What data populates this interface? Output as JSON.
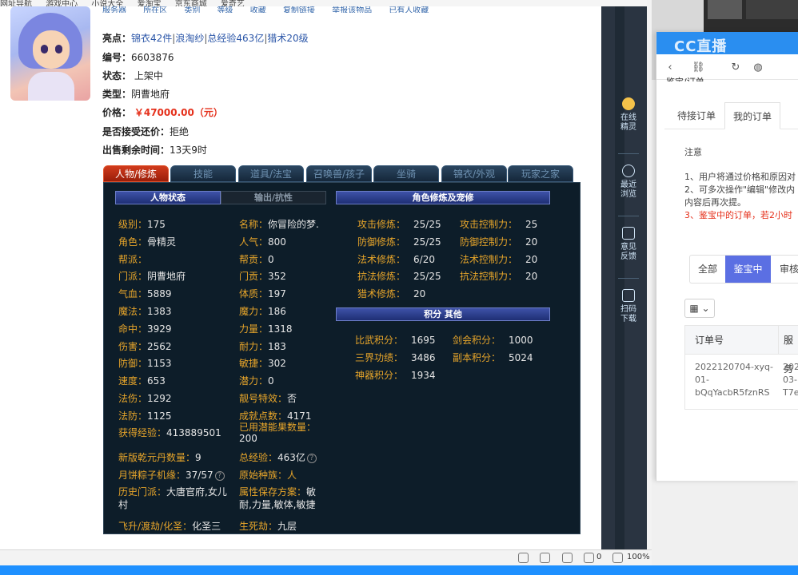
{
  "bookmarks": [
    "网址导航",
    "游戏中心",
    "小说大全",
    "爱淘宝",
    "京东商城",
    "爱奇艺"
  ],
  "meta_top": [
    "服务器",
    "所在区",
    "类别",
    "等级",
    "收藏",
    "复制链接",
    "举报该物品",
    "已有人收藏"
  ],
  "info": {
    "highlights_label": "亮点：",
    "highlights": [
      "锦衣42件",
      "浪淘纱",
      "总经验463亿",
      "猎术20级"
    ],
    "id_label": "编号：",
    "id_value": "6603876",
    "status_label": "状态：",
    "status_value": "上架中",
    "type_label": "类型：",
    "type_value": "阴曹地府",
    "price_label": "价格：",
    "price_value": "￥47000.00（元）",
    "bargain_label": "是否接受还价：",
    "bargain_value": "拒绝",
    "remaining_label": "出售剩余时间：",
    "remaining_value": "13天9时"
  },
  "tabs": [
    "人物/修炼",
    "技能",
    "道具/法宝",
    "召唤兽/孩子",
    "坐骑",
    "锦衣/外观",
    "玩家之家"
  ],
  "panel": {
    "subtab_on": "人物状态",
    "subtab_off": "输出/抗性",
    "cultivation_title": "角色修炼及宠修",
    "score_title": "积分 其他",
    "left_col": [
      {
        "k": "级别：",
        "v": "175"
      },
      {
        "k": "角色：",
        "v": "骨精灵"
      },
      {
        "k": "帮派：",
        "v": ""
      },
      {
        "k": "门派：",
        "v": "阴曹地府"
      },
      {
        "k": "气血：",
        "v": "5889"
      },
      {
        "k": "魔法：",
        "v": "1383"
      },
      {
        "k": "命中：",
        "v": "3929"
      },
      {
        "k": "伤害：",
        "v": "2562"
      },
      {
        "k": "防御：",
        "v": "1153"
      },
      {
        "k": "速度：",
        "v": "653"
      },
      {
        "k": "法伤：",
        "v": "1292"
      },
      {
        "k": "法防：",
        "v": "1125"
      }
    ],
    "mid_col": [
      {
        "k": "名称：",
        "v": "你冒险的梦."
      },
      {
        "k": "人气：",
        "v": "800"
      },
      {
        "k": "帮贡：",
        "v": "0"
      },
      {
        "k": "门贡：",
        "v": "352"
      },
      {
        "k": "体质：",
        "v": "197"
      },
      {
        "k": "魔力：",
        "v": "186"
      },
      {
        "k": "力量：",
        "v": "1318"
      },
      {
        "k": "耐力：",
        "v": "183"
      },
      {
        "k": "敏捷：",
        "v": "302"
      },
      {
        "k": "潜力：",
        "v": "0"
      },
      {
        "k": "靓号特效：",
        "v": "否"
      },
      {
        "k": "成就点数：",
        "v": "4171"
      }
    ],
    "exp_label": "获得经验：",
    "exp_value": "413889501",
    "potential_label": "已用潜能果数量：",
    "potential_value": "200",
    "qiankun_label": "新版乾元丹数量：",
    "qiankun_value": "9",
    "total_exp_label": "总经验：",
    "total_exp_value": "463亿",
    "zongzi_label": "月饼粽子机缘：",
    "zongzi_value": "37/57",
    "race_label": "原始种族：",
    "race_value": "人",
    "history_label": "历史门派：",
    "history_value_1": "大唐官府,女儿",
    "history_value_2": "村",
    "attr_label": "属性保存方案：",
    "attr_label_2": "敏",
    "attr_value": "耐,力量,敏体,敏捷",
    "fly_label": "飞升/渡劫/化圣：",
    "fly_value": "化圣三",
    "life_label": "生死劫：",
    "life_value": "九层",
    "cultivation": [
      {
        "k": "攻击修炼：",
        "v": "25/25",
        "k2": "攻击控制力：",
        "v2": "25"
      },
      {
        "k": "防御修炼：",
        "v": "25/25",
        "k2": "防御控制力：",
        "v2": "20"
      },
      {
        "k": "法术修炼：",
        "v": "6/20",
        "k2": "法术控制力：",
        "v2": "20"
      },
      {
        "k": "抗法修炼：",
        "v": "25/25",
        "k2": "抗法控制力：",
        "v2": "20"
      },
      {
        "k": "猎术修炼：",
        "v": "20",
        "k2": "",
        "v2": ""
      }
    ],
    "scores": [
      {
        "k": "比武积分：",
        "v": "1695",
        "k2": "剑会积分：",
        "v2": "1000"
      },
      {
        "k": "三界功绩：",
        "v": "3486",
        "k2": "副本积分：",
        "v2": "5024"
      },
      {
        "k": "神器积分：",
        "v": "1934",
        "k2": "",
        "v2": ""
      }
    ],
    "help_glyph": "?"
  },
  "rail": [
    {
      "label1": "在线",
      "label2": "精灵"
    },
    {
      "label1": "最近",
      "label2": "浏览"
    },
    {
      "label1": "意见",
      "label2": "反馈"
    },
    {
      "label1": "扫码",
      "label2": "下载"
    }
  ],
  "status_bar": {
    "count": "0",
    "zoom": "100%"
  },
  "sidewin": {
    "brand": "CC直播",
    "crumb": "鉴宝/订单",
    "tabs": [
      "待接订单",
      "我的订单"
    ],
    "notice_title": "注意",
    "notice_lines": [
      "1、用户将通过价格和原因对",
      "2、可多次操作\"编辑\"修改内",
      "内容后再次提。",
      "3、鉴宝中的订单，若2小时"
    ],
    "filters": [
      "全部",
      "鉴宝中",
      "审核"
    ],
    "grid_icon": "▦ ⌄",
    "table_headers": [
      "订单号",
      "服务"
    ],
    "order_lines": [
      "2022120704-xyq-",
      "01-",
      "bQqYacbR5fznRS"
    ],
    "service_lines": [
      "202",
      "03-",
      "T7e"
    ]
  },
  "colors": {
    "accent_red": "#e5301b",
    "panel_bg": "#0d1d29",
    "label_gold": "#e7a52a",
    "link_blue": "#2b56a8",
    "filter_active": "#5b6fe3"
  }
}
